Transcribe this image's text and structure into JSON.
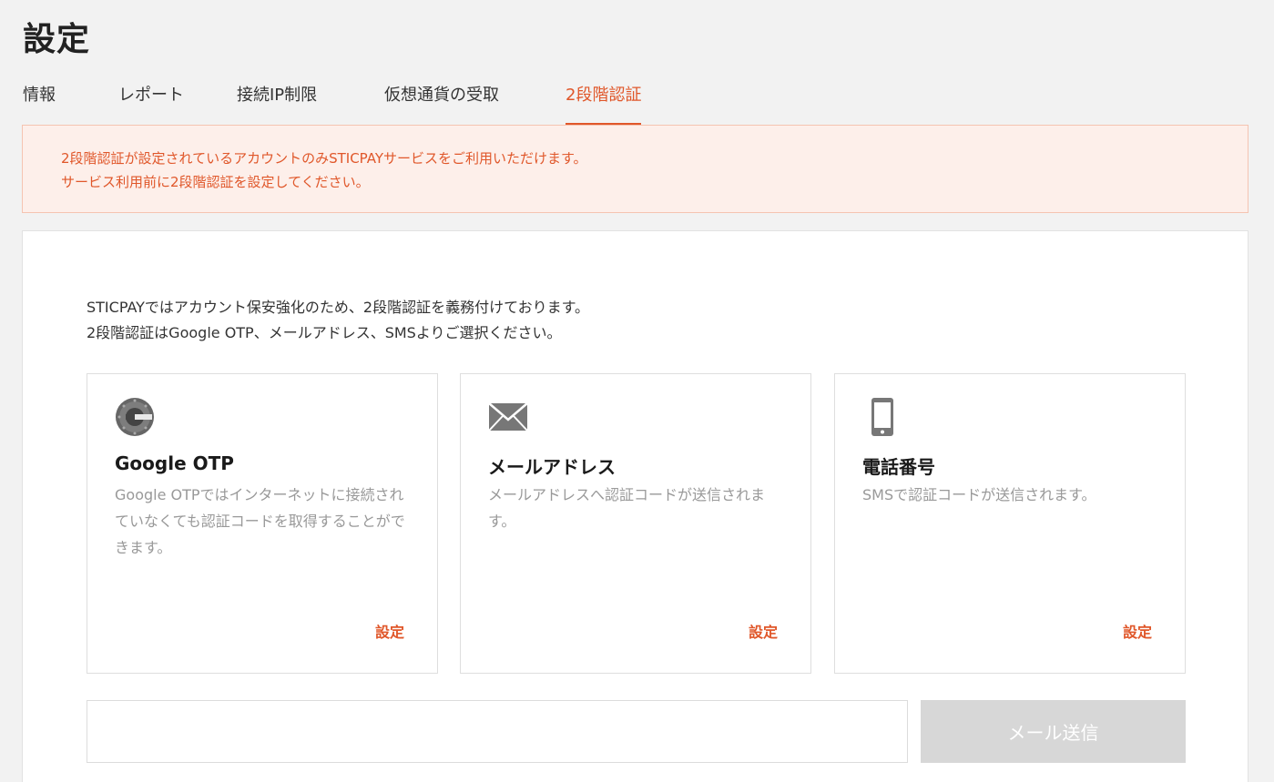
{
  "page_title": "設定",
  "tabs": [
    {
      "label": "情報"
    },
    {
      "label": "レポート"
    },
    {
      "label": "接続IP制限"
    },
    {
      "label": "仮想通貨の受取"
    },
    {
      "label": "2段階認証",
      "active": true
    }
  ],
  "alert": {
    "line1": "2段階認証が設定されているアカウントのみSTICPAYサービスをご利用いただけます。",
    "line2": "サービス利用前に2段階認証を設定してください。"
  },
  "intro": {
    "line1": "STICPAYではアカウント保安強化のため、2段階認証を義務付けております。",
    "line2": "2段階認証はGoogle OTP、メールアドレス、SMSよりご選択ください。"
  },
  "cards": [
    {
      "icon": "google-authenticator-icon",
      "title": "Google OTP",
      "description": "Google OTPではインターネットに接続されていなくても認証コードを取得することができます。",
      "action": "設定"
    },
    {
      "icon": "envelope-icon",
      "title": "メールアドレス",
      "description": "メールアドレスへ認証コードが送信されます。",
      "action": "設定"
    },
    {
      "icon": "smartphone-icon",
      "title": "電話番号",
      "description": "SMSで認証コードが送信されます。",
      "action": "設定"
    }
  ],
  "email_form": {
    "input_value": "",
    "input_placeholder": "",
    "send_label": "メール送信"
  },
  "colors": {
    "accent": "#e0572a",
    "alert_bg": "#fdefea",
    "alert_border": "#f5c4b1",
    "disabled_button": "#d7d7d7",
    "background": "#f2f2f2"
  }
}
